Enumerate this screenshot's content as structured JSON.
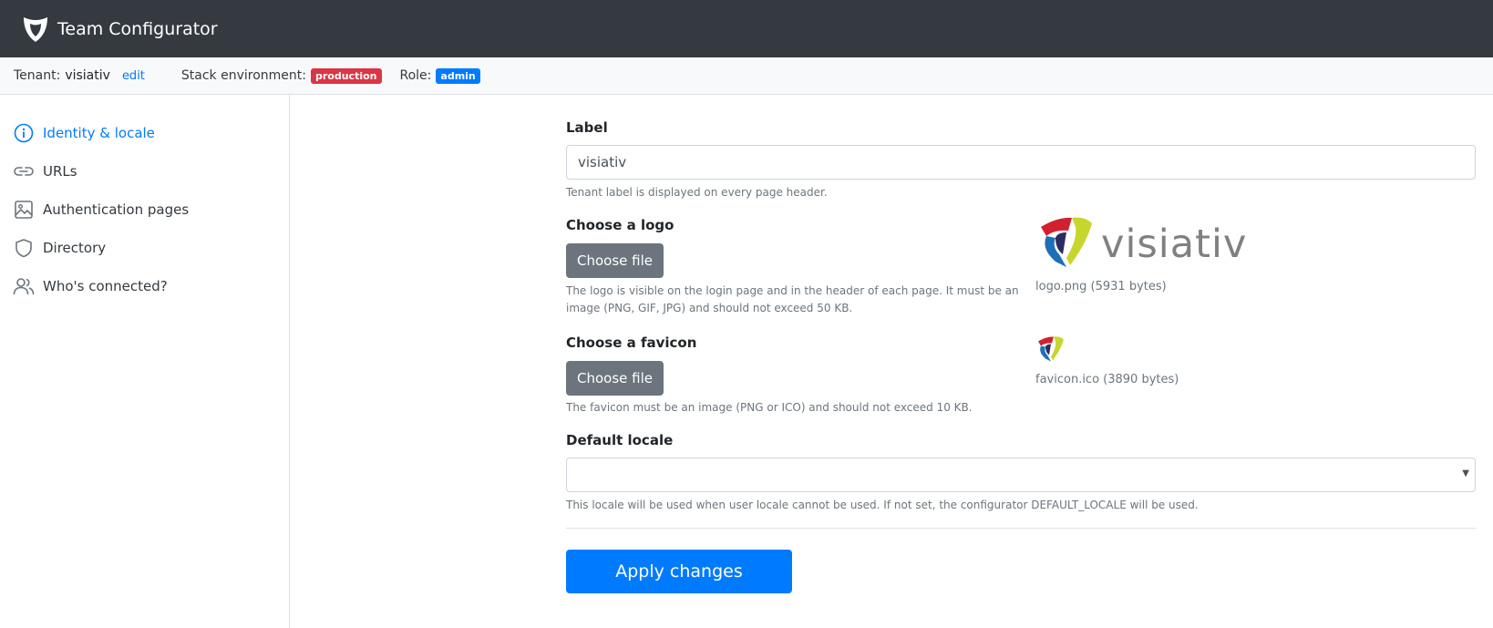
{
  "navbar": {
    "title": "Team Configurator",
    "logo_icon": "shield-logo-icon"
  },
  "subbar": {
    "tenant_label": "Tenant:",
    "tenant_value": "visiativ",
    "edit_label": "edit",
    "stack_label": "Stack environment:",
    "stack_badge": "production",
    "role_label": "Role:",
    "role_badge": "admin"
  },
  "sidebar": {
    "items": [
      {
        "label": "Identity & locale",
        "icon": "info-icon",
        "active": true
      },
      {
        "label": "URLs",
        "icon": "link-icon"
      },
      {
        "label": "Authentication pages",
        "icon": "image-icon"
      },
      {
        "label": "Directory",
        "icon": "shield-icon"
      },
      {
        "label": "Who's connected?",
        "icon": "people-icon"
      }
    ]
  },
  "form": {
    "label_title": "Label",
    "label_value": "visiativ",
    "label_help": "Tenant label is displayed on every page header.",
    "logo_title": "Choose a logo",
    "logo_button": "Choose file",
    "logo_help_1": "The logo is visible on the login page and in the header of each page. It must be an",
    "logo_help_2": "image (PNG, GIF, JPG) and should not exceed 50 KB.",
    "logo_wordmark": "visiativ",
    "logo_caption": "logo.png (5931 bytes)",
    "favicon_title": "Choose a favicon",
    "favicon_button": "Choose file",
    "favicon_help": "The favicon must be an image (PNG or ICO) and should not exceed 10 KB.",
    "favicon_caption": "favicon.ico (3890 bytes)",
    "locale_title": "Default locale",
    "locale_value": "",
    "locale_help": "This locale will be used when user locale cannot be used. If not set, the configurator DEFAULT_LOCALE will be used.",
    "apply_button": "Apply changes"
  },
  "colors": {
    "navbar": "#343a40",
    "primary": "#007bff",
    "danger": "#dc3545",
    "secondary": "#6c757d"
  }
}
